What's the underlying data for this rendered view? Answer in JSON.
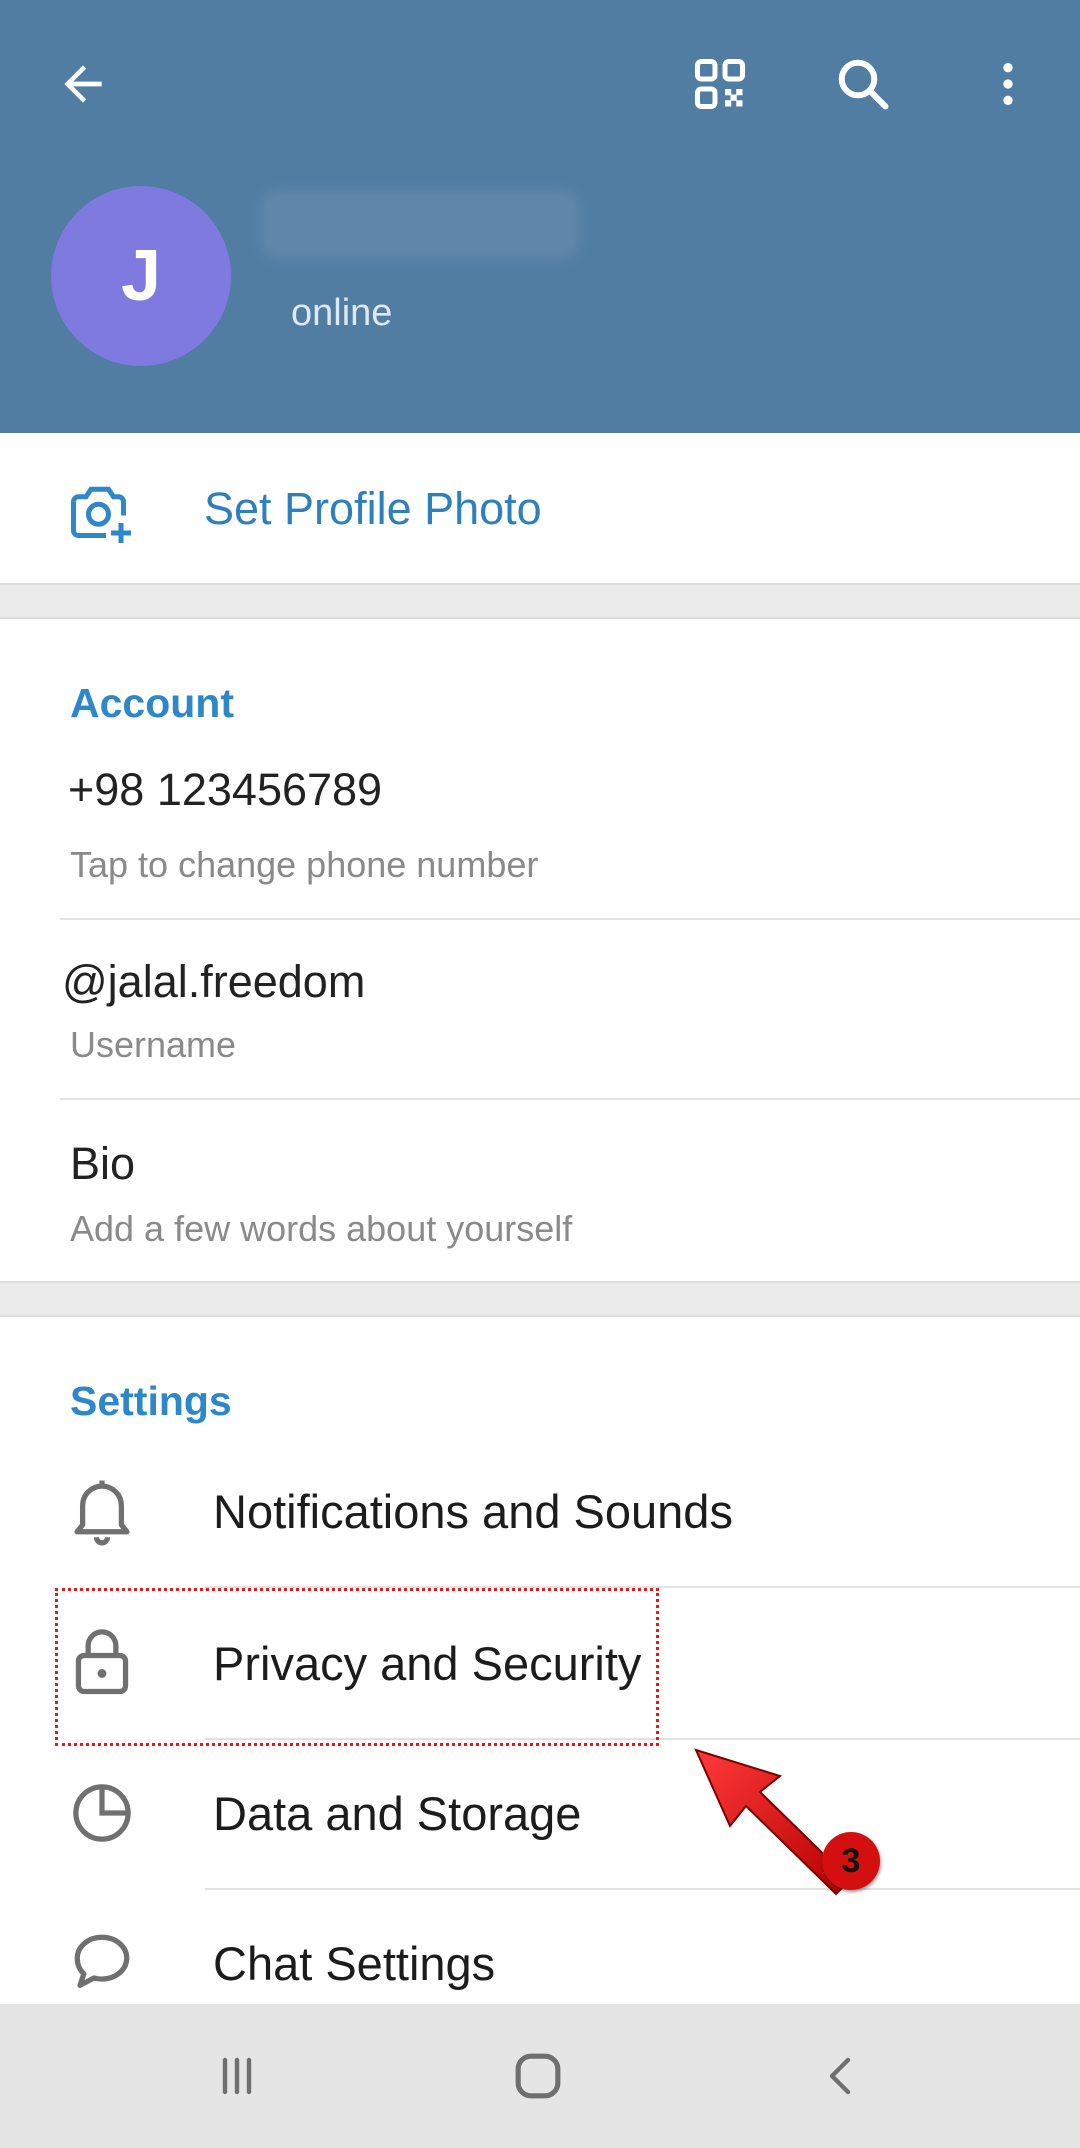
{
  "header": {
    "back_icon": "arrow-left-icon",
    "qr_icon": "qr-code-icon",
    "search_icon": "search-icon",
    "more_icon": "more-vertical-icon",
    "avatar_letter": "J",
    "status": "online",
    "color": "#517da2",
    "avatar_color": "#7f7ae0"
  },
  "profile_photo": {
    "icon": "camera-add-icon",
    "label": "Set Profile Photo"
  },
  "account": {
    "heading": "Account",
    "phone": "+98 123456789",
    "phone_hint": "Tap to change phone number",
    "username": "@jalal.freedom",
    "username_label": "Username",
    "bio": "Bio",
    "bio_hint": "Add a few words about yourself"
  },
  "settings": {
    "heading": "Settings",
    "items": [
      {
        "label": "Notifications and Sounds",
        "icon": "bell-icon"
      },
      {
        "label": "Privacy and Security",
        "icon": "lock-icon"
      },
      {
        "label": "Data and Storage",
        "icon": "clock-pie-icon"
      },
      {
        "label": "Chat Settings",
        "icon": "chat-bubble-icon"
      }
    ]
  },
  "annotation": {
    "step_number": "3",
    "color": "#e11b1b"
  },
  "navbar": {
    "recents_icon": "recents-icon",
    "home_icon": "home-icon",
    "back_icon": "back-chevron-icon"
  }
}
